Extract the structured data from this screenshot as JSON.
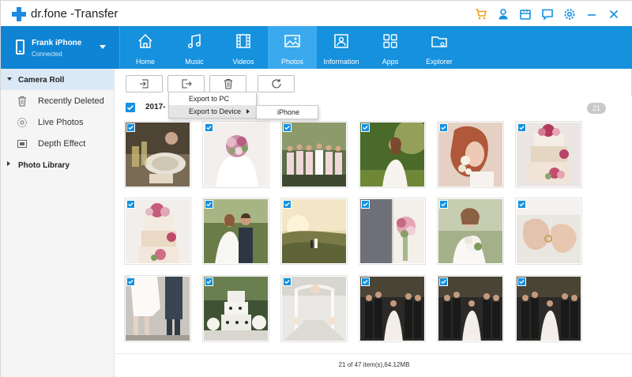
{
  "app": {
    "title": "dr.fone -Transfer"
  },
  "title_icons": [
    "cart-icon",
    "user-icon",
    "feedback-icon",
    "message-icon",
    "settings-icon",
    "minimize-icon",
    "close-icon"
  ],
  "device": {
    "name": "Frank iPhone",
    "status": "Connected"
  },
  "tabs": [
    {
      "label": "Home",
      "icon": "home-icon"
    },
    {
      "label": "Music",
      "icon": "music-icon"
    },
    {
      "label": "Videos",
      "icon": "video-icon"
    },
    {
      "label": "Photos",
      "icon": "photo-icon",
      "active": true
    },
    {
      "label": "Information",
      "icon": "contacts-icon"
    },
    {
      "label": "Apps",
      "icon": "apps-icon"
    },
    {
      "label": "Explorer",
      "icon": "folder-icon"
    }
  ],
  "sidebar": {
    "camera_roll": "Camera Roll",
    "items": [
      {
        "label": "Recently Deleted",
        "icon": "trash-icon"
      },
      {
        "label": "Live Photos",
        "icon": "live-photo-icon"
      },
      {
        "label": "Depth Effect",
        "icon": "depth-icon"
      }
    ],
    "photo_library": "Photo Library"
  },
  "toolbar": [
    "import-icon",
    "export-icon",
    "delete-icon",
    "refresh-icon"
  ],
  "context_menu": {
    "export_pc": "Export to PC",
    "export_device": "Export to Device",
    "submenu_iphone": "iPhone"
  },
  "group": {
    "date": "2017-",
    "count": "21"
  },
  "status": {
    "text": "21 of 47 item(s),64.12MB"
  },
  "colors": {
    "accent": "#1591de",
    "nav_active": "#3aa9ee",
    "device_bg": "#0f84d4"
  }
}
